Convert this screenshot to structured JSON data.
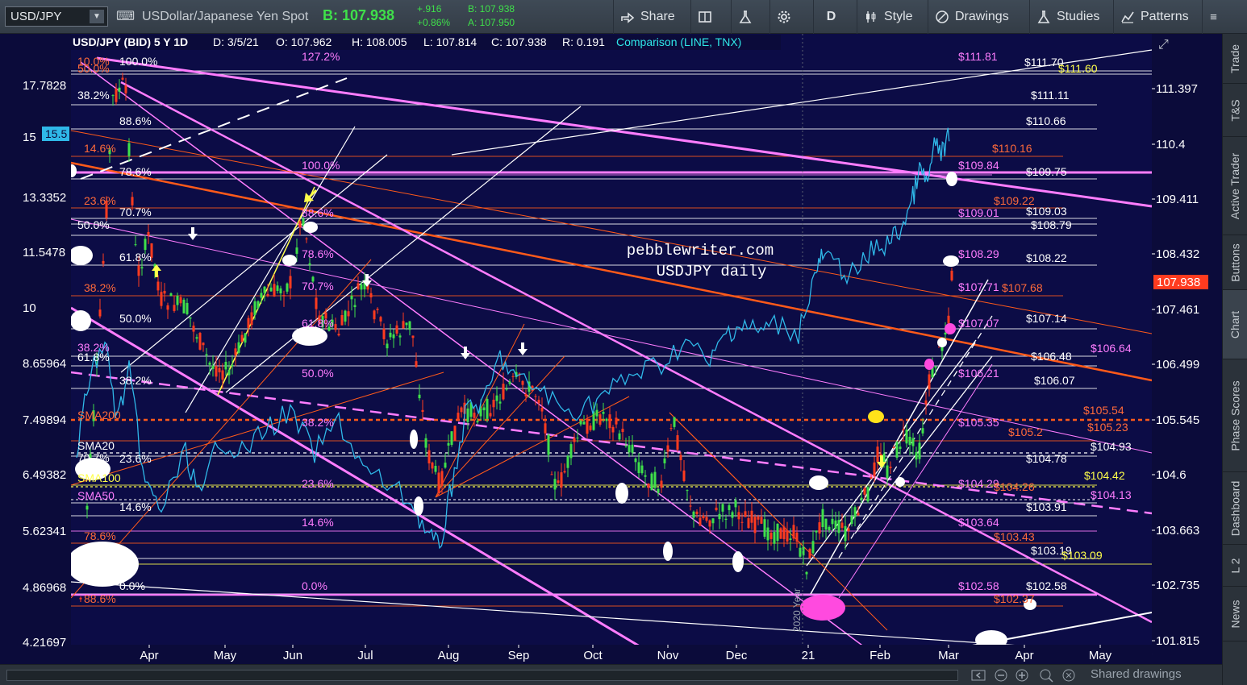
{
  "toolbar": {
    "symbol": "USD/JPY",
    "description": "USDollar/Japanese Yen Spot",
    "last": "B: 107.938",
    "change_abs": "+.916",
    "change_pct": "+0.86%",
    "bid": "B: 107.938",
    "ask": "A: 107.950",
    "share_label": "Share",
    "period_label": "D",
    "style_label": "Style",
    "drawings_label": "Drawings",
    "studies_label": "Studies",
    "patterns_label": "Patterns"
  },
  "header": {
    "instrument": "USD/JPY (BID) 5 Y 1D",
    "date": "D: 3/5/21",
    "open": "O: 107.962",
    "high": "H: 108.005",
    "low": "L: 107.814",
    "close": "C: 107.938",
    "range": "R: 0.191",
    "comparison": "Comparison (LINE, TNX)"
  },
  "watermark": {
    "line1": "pebblewriter.com",
    "line2": "USDJPY daily"
  },
  "axis": {
    "right_ticks": [
      "111.397",
      "110.4",
      "109.411",
      "108.432",
      "107.461",
      "106.499",
      "105.545",
      "104.6",
      "103.663",
      "102.735",
      "101.815"
    ],
    "left_ticks": [
      "17.7828",
      "15.5",
      "13.3352",
      "11.5478",
      "10",
      "8.65964",
      "7.49894",
      "6.49382",
      "5.62341",
      "4.86968",
      "4.21697"
    ],
    "left_badge": "15.5",
    "months": [
      "Apr",
      "May",
      "Jun",
      "Jul",
      "Aug",
      "Sep",
      "Oct",
      "Nov",
      "Dec",
      "21",
      "Feb",
      "Mar",
      "Apr",
      "May"
    ],
    "last_price": "107.938",
    "year_label": "2020 Year"
  },
  "price_labels": [
    {
      "text": "$111.81",
      "color": "#ff7dff"
    },
    {
      "text": "$111.70",
      "color": "#ffffff"
    },
    {
      "text": "$111.60",
      "color": "#ffff4a"
    },
    {
      "text": "$111.11",
      "color": "#ffffff"
    },
    {
      "text": "$110.66",
      "color": "#ffffff"
    },
    {
      "text": "$110.16",
      "color": "#ff6a3a"
    },
    {
      "text": "$109.84",
      "color": "#ff7dff"
    },
    {
      "text": "$109.75",
      "color": "#ffffff"
    },
    {
      "text": "$109.22",
      "color": "#ff6a3a"
    },
    {
      "text": "$109.01",
      "color": "#ff7dff"
    },
    {
      "text": "$109.03",
      "color": "#ffffff"
    },
    {
      "text": "$108.79",
      "color": "#ffffff"
    },
    {
      "text": "$108.29",
      "color": "#ff7dff"
    },
    {
      "text": "$108.22",
      "color": "#ffffff"
    },
    {
      "text": "$107.71",
      "color": "#ff7dff"
    },
    {
      "text": "$107.68",
      "color": "#ff6a3a"
    },
    {
      "text": "$107.07",
      "color": "#ff7dff"
    },
    {
      "text": "$107.14",
      "color": "#ffffff"
    },
    {
      "text": "$106.64",
      "color": "#ff7dff"
    },
    {
      "text": "$106.48",
      "color": "#ffffff"
    },
    {
      "text": "$106.21",
      "color": "#ff7dff"
    },
    {
      "text": "$106.07",
      "color": "#ffffff"
    },
    {
      "text": "$105.54",
      "color": "#ff6a3a"
    },
    {
      "text": "$105.35",
      "color": "#ff7dff"
    },
    {
      "text": "$105.23",
      "color": "#ff6a3a"
    },
    {
      "text": "$105.2",
      "color": "#ff6a3a"
    },
    {
      "text": "$104.93",
      "color": "#ffffff"
    },
    {
      "text": "$104.78",
      "color": "#ffffff"
    },
    {
      "text": "$104.42",
      "color": "#ffff4a"
    },
    {
      "text": "$104.29",
      "color": "#ff7dff"
    },
    {
      "text": "$104.26",
      "color": "#ff6a3a"
    },
    {
      "text": "$104.13",
      "color": "#ff7dff"
    },
    {
      "text": "$103.91",
      "color": "#ffffff"
    },
    {
      "text": "$103.64",
      "color": "#ff7dff"
    },
    {
      "text": "$103.43",
      "color": "#ff6a3a"
    },
    {
      "text": "$103.19",
      "color": "#ffffff"
    },
    {
      "text": "$103.09",
      "color": "#ffff4a"
    },
    {
      "text": "$102.58",
      "color": "#ff7dff"
    },
    {
      "text": "$102.58",
      "color": "#ffffff"
    },
    {
      "text": "$102.37",
      "color": "#ff6a3a"
    }
  ],
  "fib_labels": [
    {
      "text": "100.0%",
      "color": "#ffffff"
    },
    {
      "text": "127.2%",
      "color": "#ff7dff"
    },
    {
      "text": "38.2%",
      "color": "#ffffff"
    },
    {
      "text": "88.6%",
      "color": "#ffffff"
    },
    {
      "text": "14.6%",
      "color": "#ff6a3a"
    },
    {
      "text": "78.6%",
      "color": "#ffffff"
    },
    {
      "text": "100.0%",
      "color": "#ff7dff"
    },
    {
      "text": "23.6%",
      "color": "#ff6a3a"
    },
    {
      "text": "70.7%",
      "color": "#ffffff"
    },
    {
      "text": "88.6%",
      "color": "#ff7dff"
    },
    {
      "text": "50.0%",
      "color": "#ffffff"
    },
    {
      "text": "61.8%",
      "color": "#ffffff"
    },
    {
      "text": "78.6%",
      "color": "#ff7dff"
    },
    {
      "text": "38.2%",
      "color": "#ff6a3a"
    },
    {
      "text": "70.7%",
      "color": "#ff7dff"
    },
    {
      "text": "50.0%",
      "color": "#ffffff"
    },
    {
      "text": "61.8%",
      "color": "#ff7dff"
    },
    {
      "text": "38.2%",
      "color": "#ff7dff"
    },
    {
      "text": "61.8%",
      "color": "#ffffff"
    },
    {
      "text": "50.0%",
      "color": "#ff7dff"
    },
    {
      "text": "38.2%",
      "color": "#ffffff"
    },
    {
      "text": "38.2%",
      "color": "#ff7dff"
    },
    {
      "text": "23.6%",
      "color": "#ffffff"
    },
    {
      "text": "70.7%",
      "color": "#ffffff"
    },
    {
      "text": "23.6%",
      "color": "#ff7dff"
    },
    {
      "text": "14.6%",
      "color": "#ffffff"
    },
    {
      "text": "14.6%",
      "color": "#ff7dff"
    },
    {
      "text": "78.6%",
      "color": "#ff6a3a"
    },
    {
      "text": "0.0%",
      "color": "#ffffff"
    },
    {
      "text": "0.0%",
      "color": "#ff7dff"
    },
    {
      "text": "88.6%",
      "color": "#ff6a3a"
    },
    {
      "text": "50.0%",
      "color": "#ff6a3a"
    },
    {
      "text": "10.0%",
      "color": "#ff6a3a"
    }
  ],
  "sma_labels": [
    {
      "text": "SMA200",
      "color": "#ff6a3a"
    },
    {
      "text": "SMA20",
      "color": "#ffffff"
    },
    {
      "text": "SMA100",
      "color": "#ffff4a"
    },
    {
      "text": "SMA50",
      "color": "#ff7dff"
    }
  ],
  "sidebar": {
    "tabs": [
      "Trade",
      "T&S",
      "Active Trader",
      "Buttons",
      "Chart",
      "Phase Scores",
      "Dashboard",
      "L 2",
      "News"
    ]
  },
  "bottom": {
    "shared_label": "Shared drawings"
  },
  "colors": {
    "background": "#0b0b3a",
    "up": "#3fe04a",
    "down": "#ff3b1f",
    "pink": "#ff7dff",
    "orange": "#ff5a1a",
    "tnx": "#2fb8e8"
  }
}
